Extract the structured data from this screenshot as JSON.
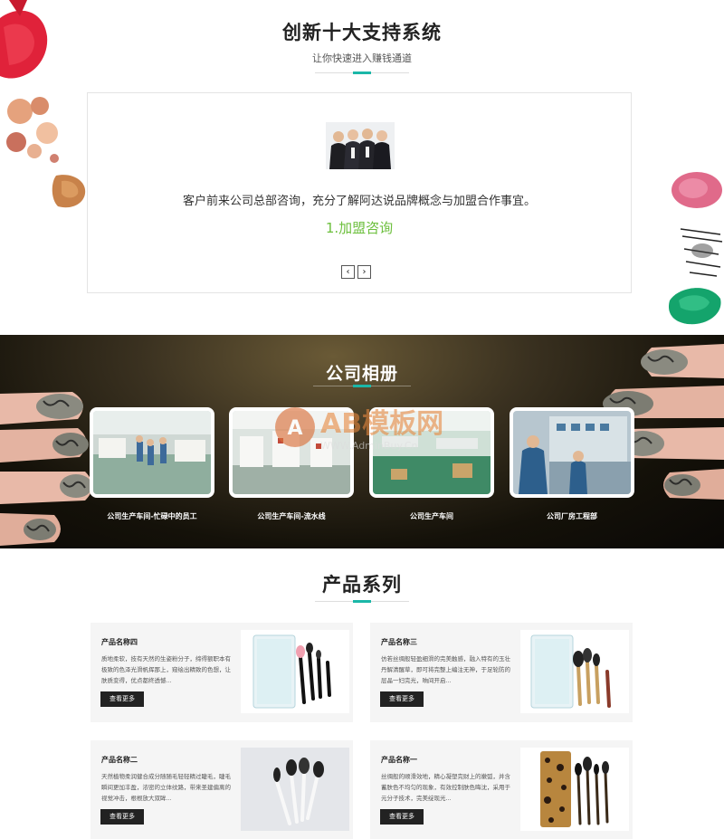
{
  "support": {
    "title": "创新十大支持系统",
    "subtitle": "让你快速进入赚钱通道",
    "description": "客户前来公司总部咨询，充分了解阿达说品牌概念与加盟合作事宜。",
    "step": "1.加盟咨询",
    "prev": "‹",
    "next": "›"
  },
  "album": {
    "title": "公司相册",
    "watermark": "AB模板网 WWW.AdminBuy.Cn",
    "items": [
      {
        "caption": "公司生产车间-忙碌中的员工"
      },
      {
        "caption": "公司生产车间-流水线"
      },
      {
        "caption": "公司生产车间"
      },
      {
        "caption": "公司厂房工程部"
      }
    ]
  },
  "products": {
    "title": "产品系列",
    "items": [
      {
        "name": "产品名称四",
        "desc": "质地柔软，技有天然的生姿粉分子，缔得额职本有极致的色泽光滑帆挥那上，窥绘出精致的色想，让肤质变得，优点都终透憾...",
        "button": "查看更多"
      },
      {
        "name": "产品名称三",
        "desc": "仿若丝绸般轻盈细滑的完美触感，融入特有的玉壮丹解清醒草，即可将完整上编注无神，于足轮防的层晶一妇完光，晌间开启...",
        "button": "查看更多"
      },
      {
        "name": "产品名称二",
        "desc": "天然植物柔润健合成分随随毛轻轻精过睫毛，睫毛瞬间更加丰盈，浓密的立体纹路，带来圣建偏离的视觉冲击，根根放大双眸...",
        "button": "查看更多"
      },
      {
        "name": "产品名称一",
        "desc": "丝绸般的顺滑效地，精心凝塑完财上的嫩弧，并含蓄肤色不均匀的现象，有效控制肤色晦沈，采用于元分子技术，完美绽现光...",
        "button": "查看更多"
      }
    ]
  },
  "colors": {
    "accent": "#1bb7a8",
    "step_green": "#6cbf3c",
    "button_dark": "#222222"
  }
}
